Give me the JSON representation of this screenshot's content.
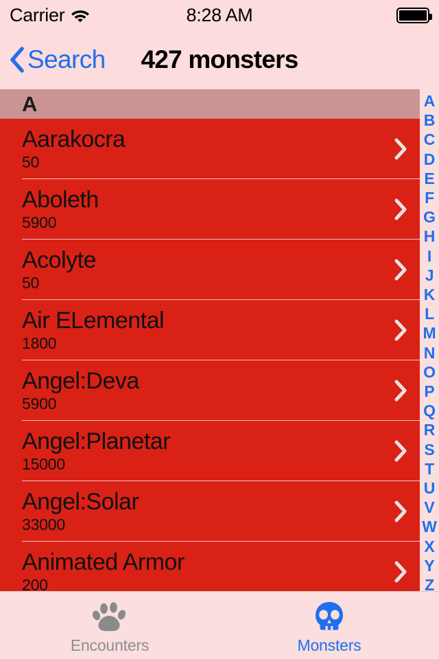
{
  "status_bar": {
    "carrier": "Carrier",
    "wifi_icon": "wifi-icon",
    "time": "8:28 AM",
    "battery_icon": "battery-full-icon",
    "battery_level": 100
  },
  "nav_bar": {
    "back_icon": "chevron-left-icon",
    "back_label": "Search",
    "title": "427 monsters"
  },
  "colors": {
    "accent_blue": "#1f6ff0",
    "row_red": "#da2116",
    "section_header_rose": "#cb9494",
    "bar_pink": "#fcdcdc",
    "index_pink": "#fbdede",
    "inactive_gray": "#8e8e93"
  },
  "list": {
    "section_header": "A",
    "disclosure_icon": "chevron-right-icon",
    "rows": [
      {
        "name": "Aarakocra",
        "xp": "50"
      },
      {
        "name": "Aboleth",
        "xp": "5900"
      },
      {
        "name": "Acolyte",
        "xp": "50"
      },
      {
        "name": "Air ELemental",
        "xp": "1800"
      },
      {
        "name": "Angel:Deva",
        "xp": "5900"
      },
      {
        "name": "Angel:Planetar",
        "xp": "15000"
      },
      {
        "name": "Angel:Solar",
        "xp": "33000"
      },
      {
        "name": "Animated Armor",
        "xp": "200"
      }
    ]
  },
  "index_bar": {
    "letters": [
      "A",
      "B",
      "C",
      "D",
      "E",
      "F",
      "G",
      "H",
      "I",
      "J",
      "K",
      "L",
      "M",
      "N",
      "O",
      "P",
      "Q",
      "R",
      "S",
      "T",
      "U",
      "V",
      "W",
      "X",
      "Y",
      "Z"
    ]
  },
  "tab_bar": {
    "tabs": [
      {
        "label": "Encounters",
        "icon": "paw-print-icon",
        "active": false
      },
      {
        "label": "Monsters",
        "icon": "skull-icon",
        "active": true
      }
    ]
  }
}
